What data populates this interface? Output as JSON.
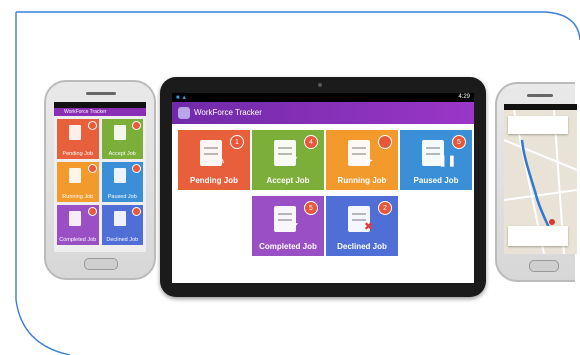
{
  "tablet": {
    "app_title": "WorkForce Tracker",
    "status_time": "4:29",
    "tiles": [
      {
        "label": "Pending Job",
        "badge": "1",
        "color": "#e85f3c",
        "icon": "document-pen-icon"
      },
      {
        "label": "Accept Job",
        "badge": "4",
        "color": "#7cae3a",
        "icon": "document-check-icon"
      },
      {
        "label": "Running Job",
        "badge": "",
        "color": "#f39a2d",
        "icon": "document-run-icon"
      },
      {
        "label": "Paused Job",
        "badge": "5",
        "color": "#3a8fd6",
        "icon": "document-pause-icon"
      },
      {
        "label": "Completed Job",
        "badge": "5",
        "color": "#9a4fc4",
        "icon": "document-checkmark-icon"
      },
      {
        "label": "Declined Job",
        "badge": "2",
        "color": "#4f6fd6",
        "icon": "document-x-icon"
      }
    ]
  },
  "phone_left": {
    "tiles": [
      {
        "label": "Pending Job",
        "color": "#e85f3c"
      },
      {
        "label": "Accept Job",
        "color": "#7cae3a"
      },
      {
        "label": "Running Job",
        "color": "#f39a2d"
      },
      {
        "label": "Paused Job",
        "color": "#3a8fd6"
      },
      {
        "label": "Completed Job",
        "color": "#9a4fc4"
      },
      {
        "label": "Declined Job",
        "color": "#4f6fd6"
      }
    ]
  },
  "colors": {
    "app_bar": "#8a2fb5",
    "frame_border": "#3b7fd8",
    "route_line": "#2f78d4"
  }
}
